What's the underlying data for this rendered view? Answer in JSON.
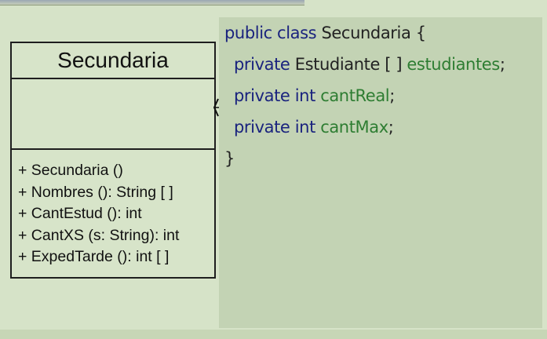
{
  "uml_class": {
    "name": "Secundaria",
    "methods": [
      "+ Secundaria ()",
      "+ Nombres (): String [ ]",
      "+ CantEstud (): int",
      "+ CantXS (s: String): int",
      "+ ExpedTarde (): int [ ]"
    ]
  },
  "code": {
    "line1": {
      "kw": "public class",
      "name": "Secundaria",
      "brace": "{"
    },
    "line2": {
      "kw": "private",
      "type": "Estudiante [ ]",
      "field": "estudiantes",
      "end": ";"
    },
    "line3": {
      "kw": "private int",
      "field": "cantReal",
      "end": ";"
    },
    "line4": {
      "kw": "private int",
      "field": "cantMax",
      "end": ";"
    },
    "line5": {
      "brace": "}"
    }
  },
  "colors": {
    "background": "#d6e3c8",
    "code_panel": "#c3d3b4",
    "keyword": "#1a237e",
    "field": "#2e7d32",
    "text": "#222222",
    "border": "#1e1e1e"
  }
}
